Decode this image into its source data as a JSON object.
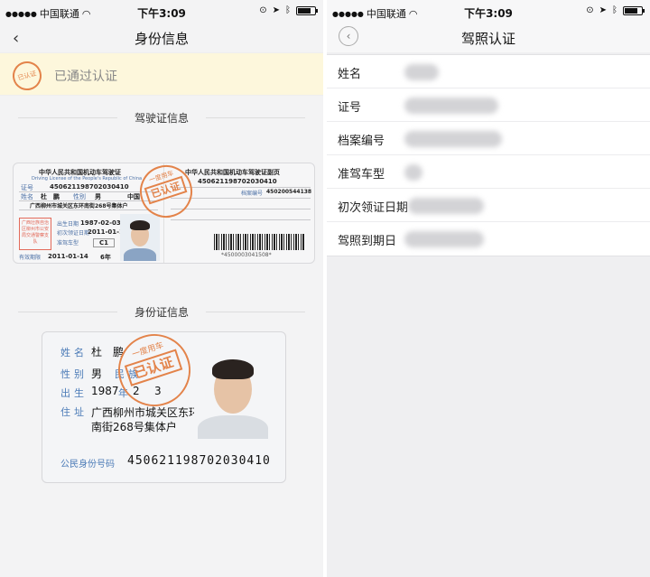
{
  "status_bar": {
    "carrier": "中国联通",
    "time": "下午3:09"
  },
  "left_screen": {
    "title": "身份信息",
    "verified_text": "已通过认证",
    "verified_stamp_text": "已认证",
    "driver_section_title": "驾驶证信息",
    "id_section_title": "身份证信息",
    "driver_license": {
      "main_title": "中华人民共和国机动车驾驶证",
      "main_subtitle": "Driving License of the People's Republic of China",
      "sub_title": "中华人民共和国机动车驾驶证副页",
      "number_label": "证号",
      "number": "450621198702030410",
      "sub_number": "450621198702030410",
      "name_label": "姓名",
      "name": "杜　鹏",
      "sex_label": "性别",
      "sex": "男",
      "nationality": "中国",
      "address": "广西柳州市城关区东环南街268号集体户",
      "file_label": "档案编号",
      "file_number": "450200544138",
      "birth_label": "出生日期",
      "birth": "1987-02-03",
      "issue_label": "初次领证日期",
      "issue_date": "2011-01-14",
      "class_label": "准驾车型",
      "class": "C1",
      "valid_label": "有效期限",
      "valid_from": "2011-01-14",
      "valid_years": "6年",
      "authority": "广西壮族自治区柳州市公安局交通警察支队",
      "barcode_number": "*4500003041508*",
      "stamp_top": "一度用车",
      "stamp_main": "已认证"
    },
    "id_card": {
      "name_label": "姓名",
      "name": "杜　鹏",
      "sex_label": "性别",
      "sex": "男",
      "ethnicity_label": "民族",
      "birth_label": "出生",
      "birth_year": "1987",
      "birth_year_unit": "年",
      "birth_month": "2",
      "birth_day": "3",
      "address_label": "住址",
      "address_line1": "广西柳州市城关区东环",
      "address_line2": "南街268号集体户",
      "id_label": "公民身份号码",
      "id_number": "450621198702030410",
      "stamp_top": "一度用车",
      "stamp_main": "已认证"
    }
  },
  "right_screen": {
    "title": "驾照认证",
    "rows": [
      {
        "label": "姓名"
      },
      {
        "label": "证号"
      },
      {
        "label": "档案编号"
      },
      {
        "label": "准驾车型"
      },
      {
        "label": "初次领证日期"
      },
      {
        "label": "驾照到期日"
      }
    ]
  },
  "colors": {
    "stamp": "#e3834a",
    "banner_bg": "#fdf7dc",
    "id_label": "#4b7bb7"
  }
}
